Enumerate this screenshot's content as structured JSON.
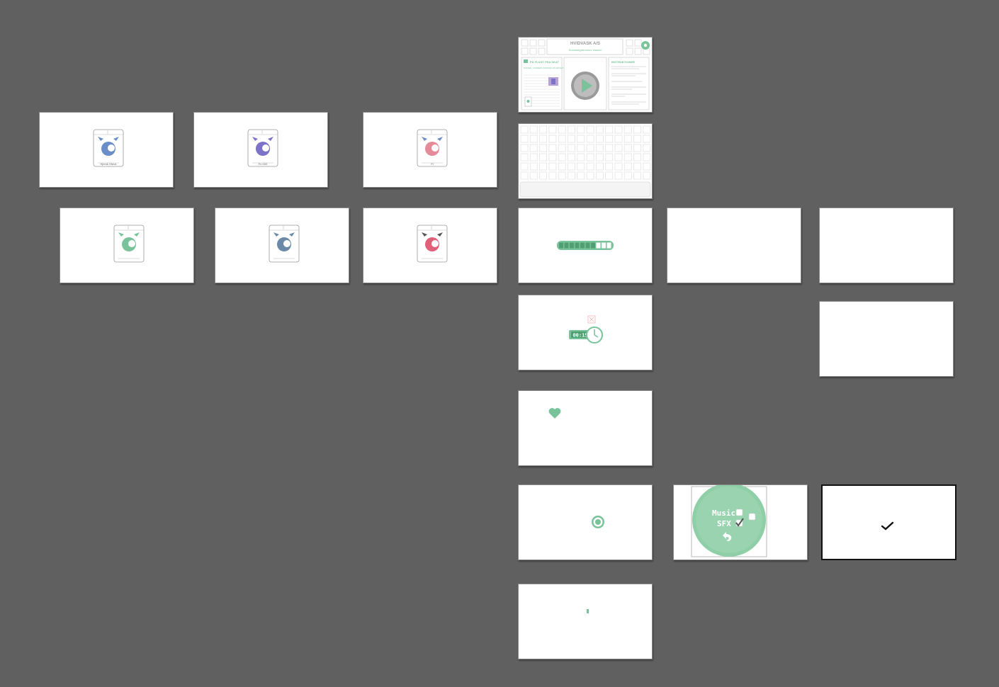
{
  "colors": {
    "canvas": "#606060",
    "accent": "#79c39a",
    "accent_dark": "#4f9f73",
    "blue": "#6c8ec8",
    "purple": "#7c72c8",
    "pink": "#e58a98",
    "teal": "#79c39a",
    "slate": "#6c8aa8",
    "grey_circle": "#9a9a9a"
  },
  "artboards": {
    "main_menu": {
      "company_title": "HVIDVASK A/S",
      "subtitle": "Socialistgrafonens Vaskeri",
      "left_panel_title": "PÅ FLUGT FRA SKAT",
      "left_panel_sub": "DOKSEN - KUNDENS HVIDVASK FRI SIMULATOR",
      "right_panel_title": "INSTRUKTIONER"
    },
    "machines": [
      {
        "id": "machine-blue",
        "eye_color": "#6c8ec8",
        "drum_color": "#6c8ec8",
        "caption": "Hjemk Gleuk"
      },
      {
        "id": "machine-purple",
        "eye_color": "#7c72c8",
        "drum_color": "#7c72c8",
        "caption": "Fu 000"
      },
      {
        "id": "machine-pink",
        "eye_color": "#6c8ec8",
        "drum_color": "#e58a98",
        "caption": "Fi"
      },
      {
        "id": "machine-teal",
        "eye_color": "#79c39a",
        "drum_color": "#79c39a",
        "caption": ""
      },
      {
        "id": "machine-slate",
        "eye_color": "#6c8aa8",
        "drum_color": "#6c8aa8",
        "caption": ""
      },
      {
        "id": "machine-red",
        "eye_color": "#555555",
        "drum_color": "#e0607a",
        "caption": ""
      }
    ],
    "hud": {
      "progress_segments_total": 10,
      "progress_segments_filled": 7,
      "timer_text": "00:15"
    },
    "settings": {
      "music_label": "Music",
      "sfx_label": "SFX",
      "music_checked": false,
      "sfx_checked": true
    }
  }
}
